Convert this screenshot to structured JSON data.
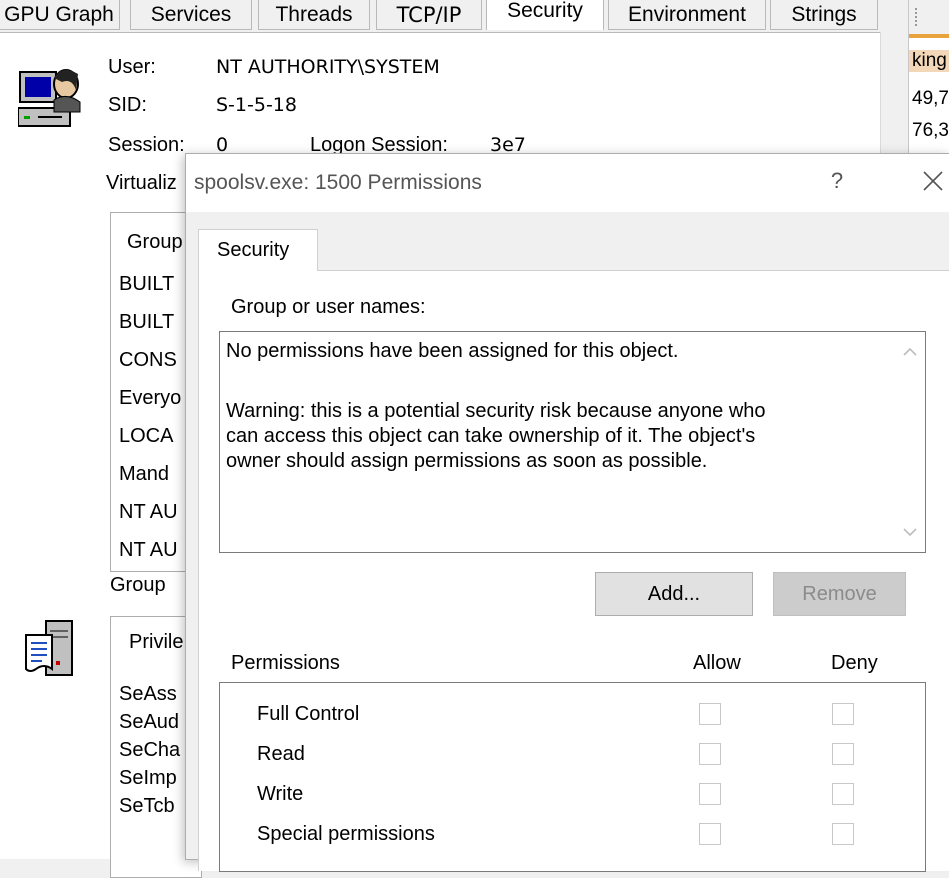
{
  "tabs": [
    {
      "label": "GPU Graph"
    },
    {
      "label": "Services"
    },
    {
      "label": "Threads"
    },
    {
      "label": "TCP/IP"
    },
    {
      "label": "Security"
    },
    {
      "label": "Environment"
    },
    {
      "label": "Strings"
    }
  ],
  "security": {
    "user_label": "User:",
    "user_value": "NT AUTHORITY\\SYSTEM",
    "sid_label": "SID:",
    "sid_value": "S-1-5-18",
    "session_label": "Session:",
    "session_value": "0",
    "logon_label": "Logon Session:",
    "logon_value": "3e7",
    "virtualized_label": "Virtualiz",
    "groups_header": "Group",
    "groups": [
      "BUILT",
      "BUILT",
      "CONS",
      "Everyo",
      "LOCA",
      "Mand",
      "NT AU",
      "NT AU"
    ],
    "group_label": "Group",
    "privileges_header": "Privile",
    "privileges": [
      "SeAss",
      "SeAud",
      "SeCha",
      "SeImp",
      "SeTcb"
    ]
  },
  "right_strip": {
    "header": "king",
    "row1": "49,7",
    "row2": "76,3"
  },
  "dialog": {
    "title": "spoolsv.exe: 1500 Permissions",
    "help_label": "?",
    "tab_label": "Security",
    "group_names_label": "Group or user names:",
    "message_line1": "No permissions have been assigned for this object.",
    "message_line2": "Warning: this is a potential security risk because anyone who",
    "message_line3": "can access this object can take ownership of it. The object's",
    "message_line4": "owner should assign permissions as soon as possible.",
    "add_label": "Add...",
    "remove_label": "Remove",
    "permissions_label": "Permissions",
    "allow_label": "Allow",
    "deny_label": "Deny",
    "permissions": [
      {
        "name": "Full Control",
        "allow": false,
        "deny": false
      },
      {
        "name": "Read",
        "allow": false,
        "deny": false
      },
      {
        "name": "Write",
        "allow": false,
        "deny": false
      },
      {
        "name": "Special permissions",
        "allow": false,
        "deny": false
      }
    ]
  },
  "colors": {
    "active_tab_bg": "#ffffff",
    "dialog_bg": "#f0f0f0",
    "accent_orange": "#e8a33d"
  }
}
